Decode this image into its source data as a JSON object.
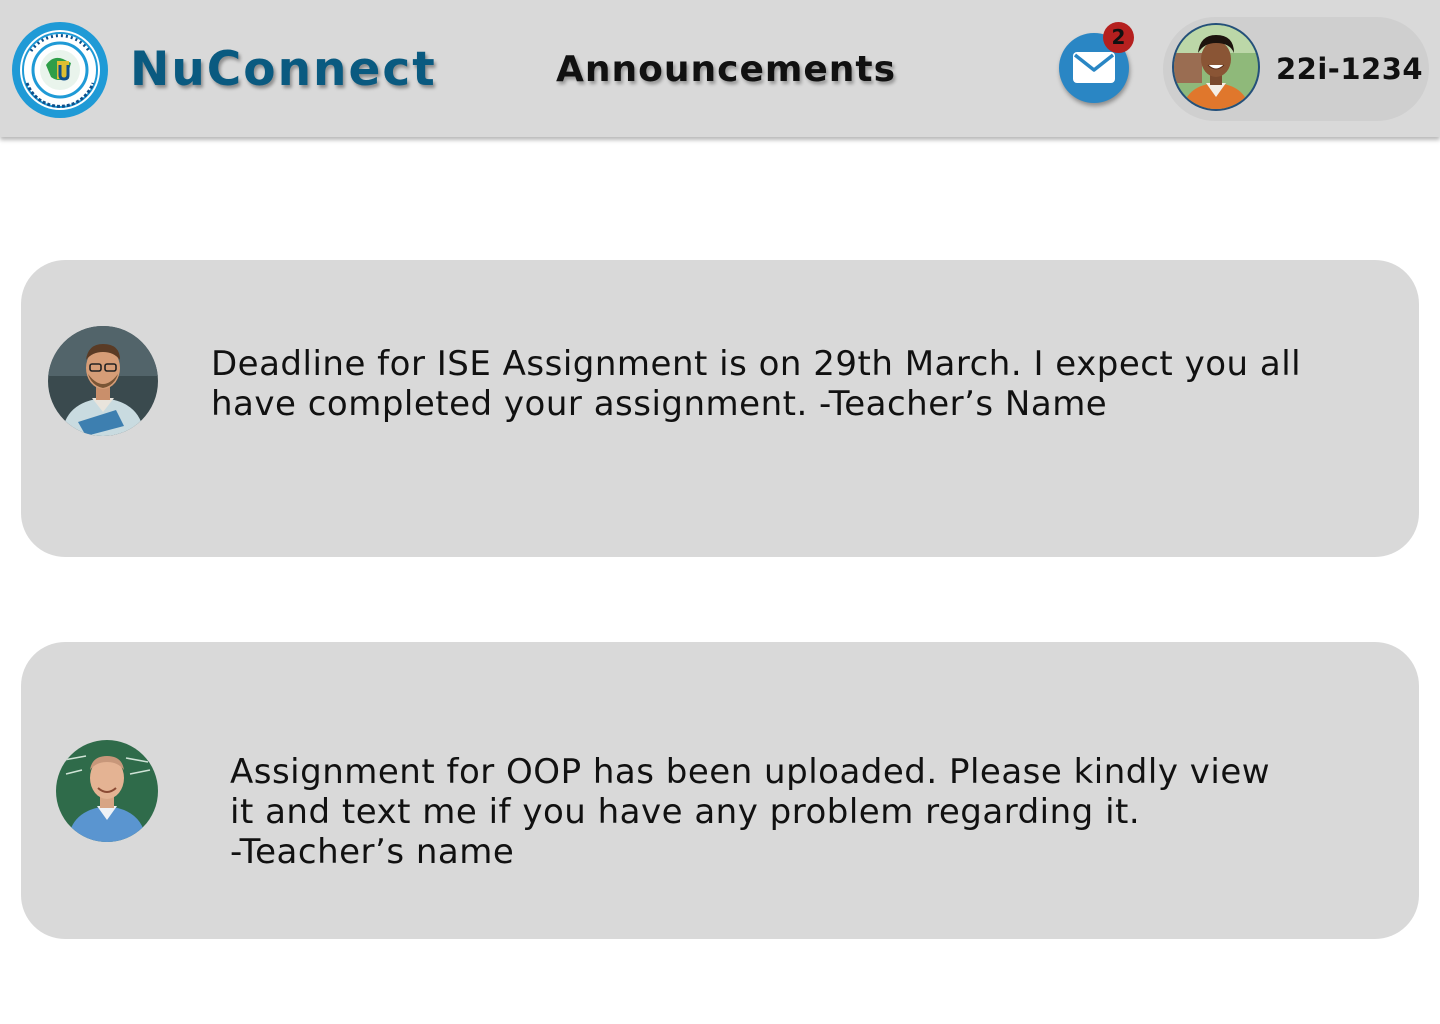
{
  "header": {
    "brand": "NuConnect",
    "page_title": "Announcements",
    "mail_icon": "envelope-icon",
    "unread_count": "2",
    "user_id": "22i-1234"
  },
  "colors": {
    "header_bg": "#d9d9d9",
    "brand": "#0a5a80",
    "mail_button": "#2a86c4",
    "badge": "#b5201f",
    "card_bg": "#d9d9d9"
  },
  "announcements": [
    {
      "text": "Deadline for ISE Assignment is on 29th March. I expect you all\nhave completed your assignment. -Teacher’s Name",
      "avatar": "teacher-avatar-glasses"
    },
    {
      "text": "Assignment for OOP has been uploaded. Please kindly view\nit and text me if you have any problem regarding it.\n-Teacher’s name",
      "avatar": "teacher-avatar-bald"
    }
  ]
}
